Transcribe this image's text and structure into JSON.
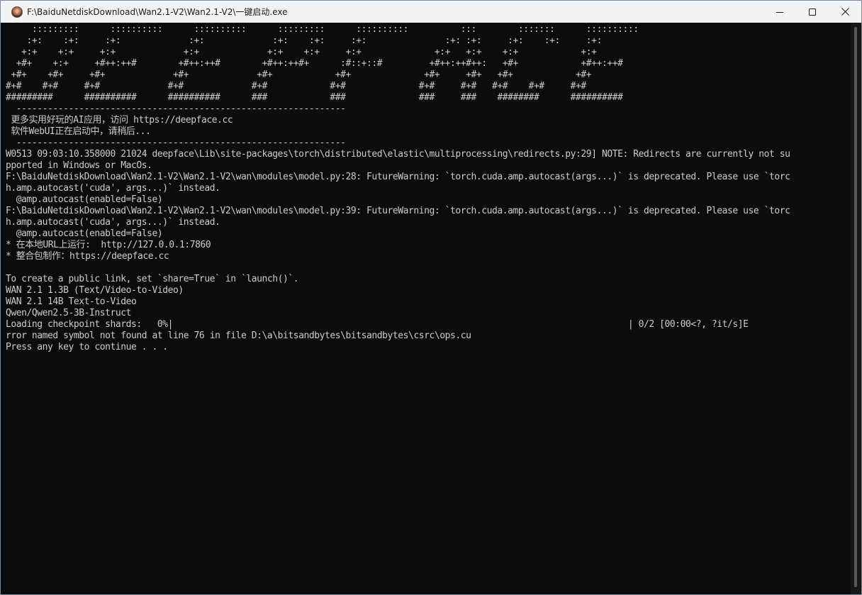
{
  "window": {
    "title": "F:\\BaiduNetdiskDownload\\Wan2.1-V2\\Wan2.1-V2\\一键启动.exe",
    "icon": "app-avatar-icon",
    "controls": {
      "minimize": "minimize-icon",
      "maximize": "maximize-icon",
      "close": "close-icon"
    }
  },
  "console": {
    "lines": [
      "     :::::::::      ::::::::::      ::::::::::      :::::::::      ::::::::::          :::        :::::::      ::::::::::",
      "    :+:    :+:     :+:             :+:             :+:    :+:     :+:               :+: :+:     :+:    :+:     :+:",
      "   +:+    +:+     +:+             +:+             +:+    +:+     +:+              +:+   +:+    +:+            +:+",
      "  +#+    +:+     +#++:++#        +#++:++#        +#++:++#+      :#::+::#         +#++:++#++:   +#+            +#++:++#",
      " +#+    +#+     +#+             +#+             +#+            +#+              +#+     +#+   +#+            +#+",
      "#+#    #+#     #+#             #+#             #+#            #+#              #+#     #+#   #+#    #+#     #+#",
      "#########      ##########      ##########      ###            ###              ###     ###    ########      ##########",
      "  ---------------------------------------------------------------",
      " 更多实用好玩的AI应用，访问 https://deepface.cc",
      " 软件WebUI正在启动中，请稍后...",
      "  ---------------------------------------------------------------",
      "W0513 09:03:10.358000 21024 deepface\\Lib\\site-packages\\torch\\distributed\\elastic\\multiprocessing\\redirects.py:29] NOTE: Redirects are currently not su",
      "pported in Windows or MacOs.",
      "F:\\BaiduNetdiskDownload\\Wan2.1-V2\\Wan2.1-V2\\wan\\modules\\model.py:28: FutureWarning: `torch.cuda.amp.autocast(args...)` is deprecated. Please use `torc",
      "h.amp.autocast('cuda', args...)` instead.",
      "  @amp.autocast(enabled=False)",
      "F:\\BaiduNetdiskDownload\\Wan2.1-V2\\Wan2.1-V2\\wan\\modules\\model.py:39: FutureWarning: `torch.cuda.amp.autocast(args...)` is deprecated. Please use `torc",
      "h.amp.autocast('cuda', args...)` instead.",
      "  @amp.autocast(enabled=False)",
      "* 在本地URL上运行:  http://127.0.0.1:7860",
      "* 整合包制作：https://deepface.cc",
      "",
      "To create a public link, set `share=True` in `launch()`.",
      "WAN 2.1 1.3B (Text/Video-to-Video)",
      "WAN 2.1 14B Text-to-Video",
      "Qwen/Qwen2.5-3B-Instruct",
      "Loading checkpoint shards:   0%|                                                                                       | 0/2 [00:00<?, ?it/s]E",
      "rror named symbol not found at line 76 in file D:\\a\\bitsandbytes\\bitsandbytes\\csrc\\ops.cu",
      "Press any key to continue . . ."
    ]
  },
  "colors": {
    "console_bg": "#0c0c0c",
    "console_text": "#cccccc",
    "titlebar_bg": "#f3f3f3"
  }
}
